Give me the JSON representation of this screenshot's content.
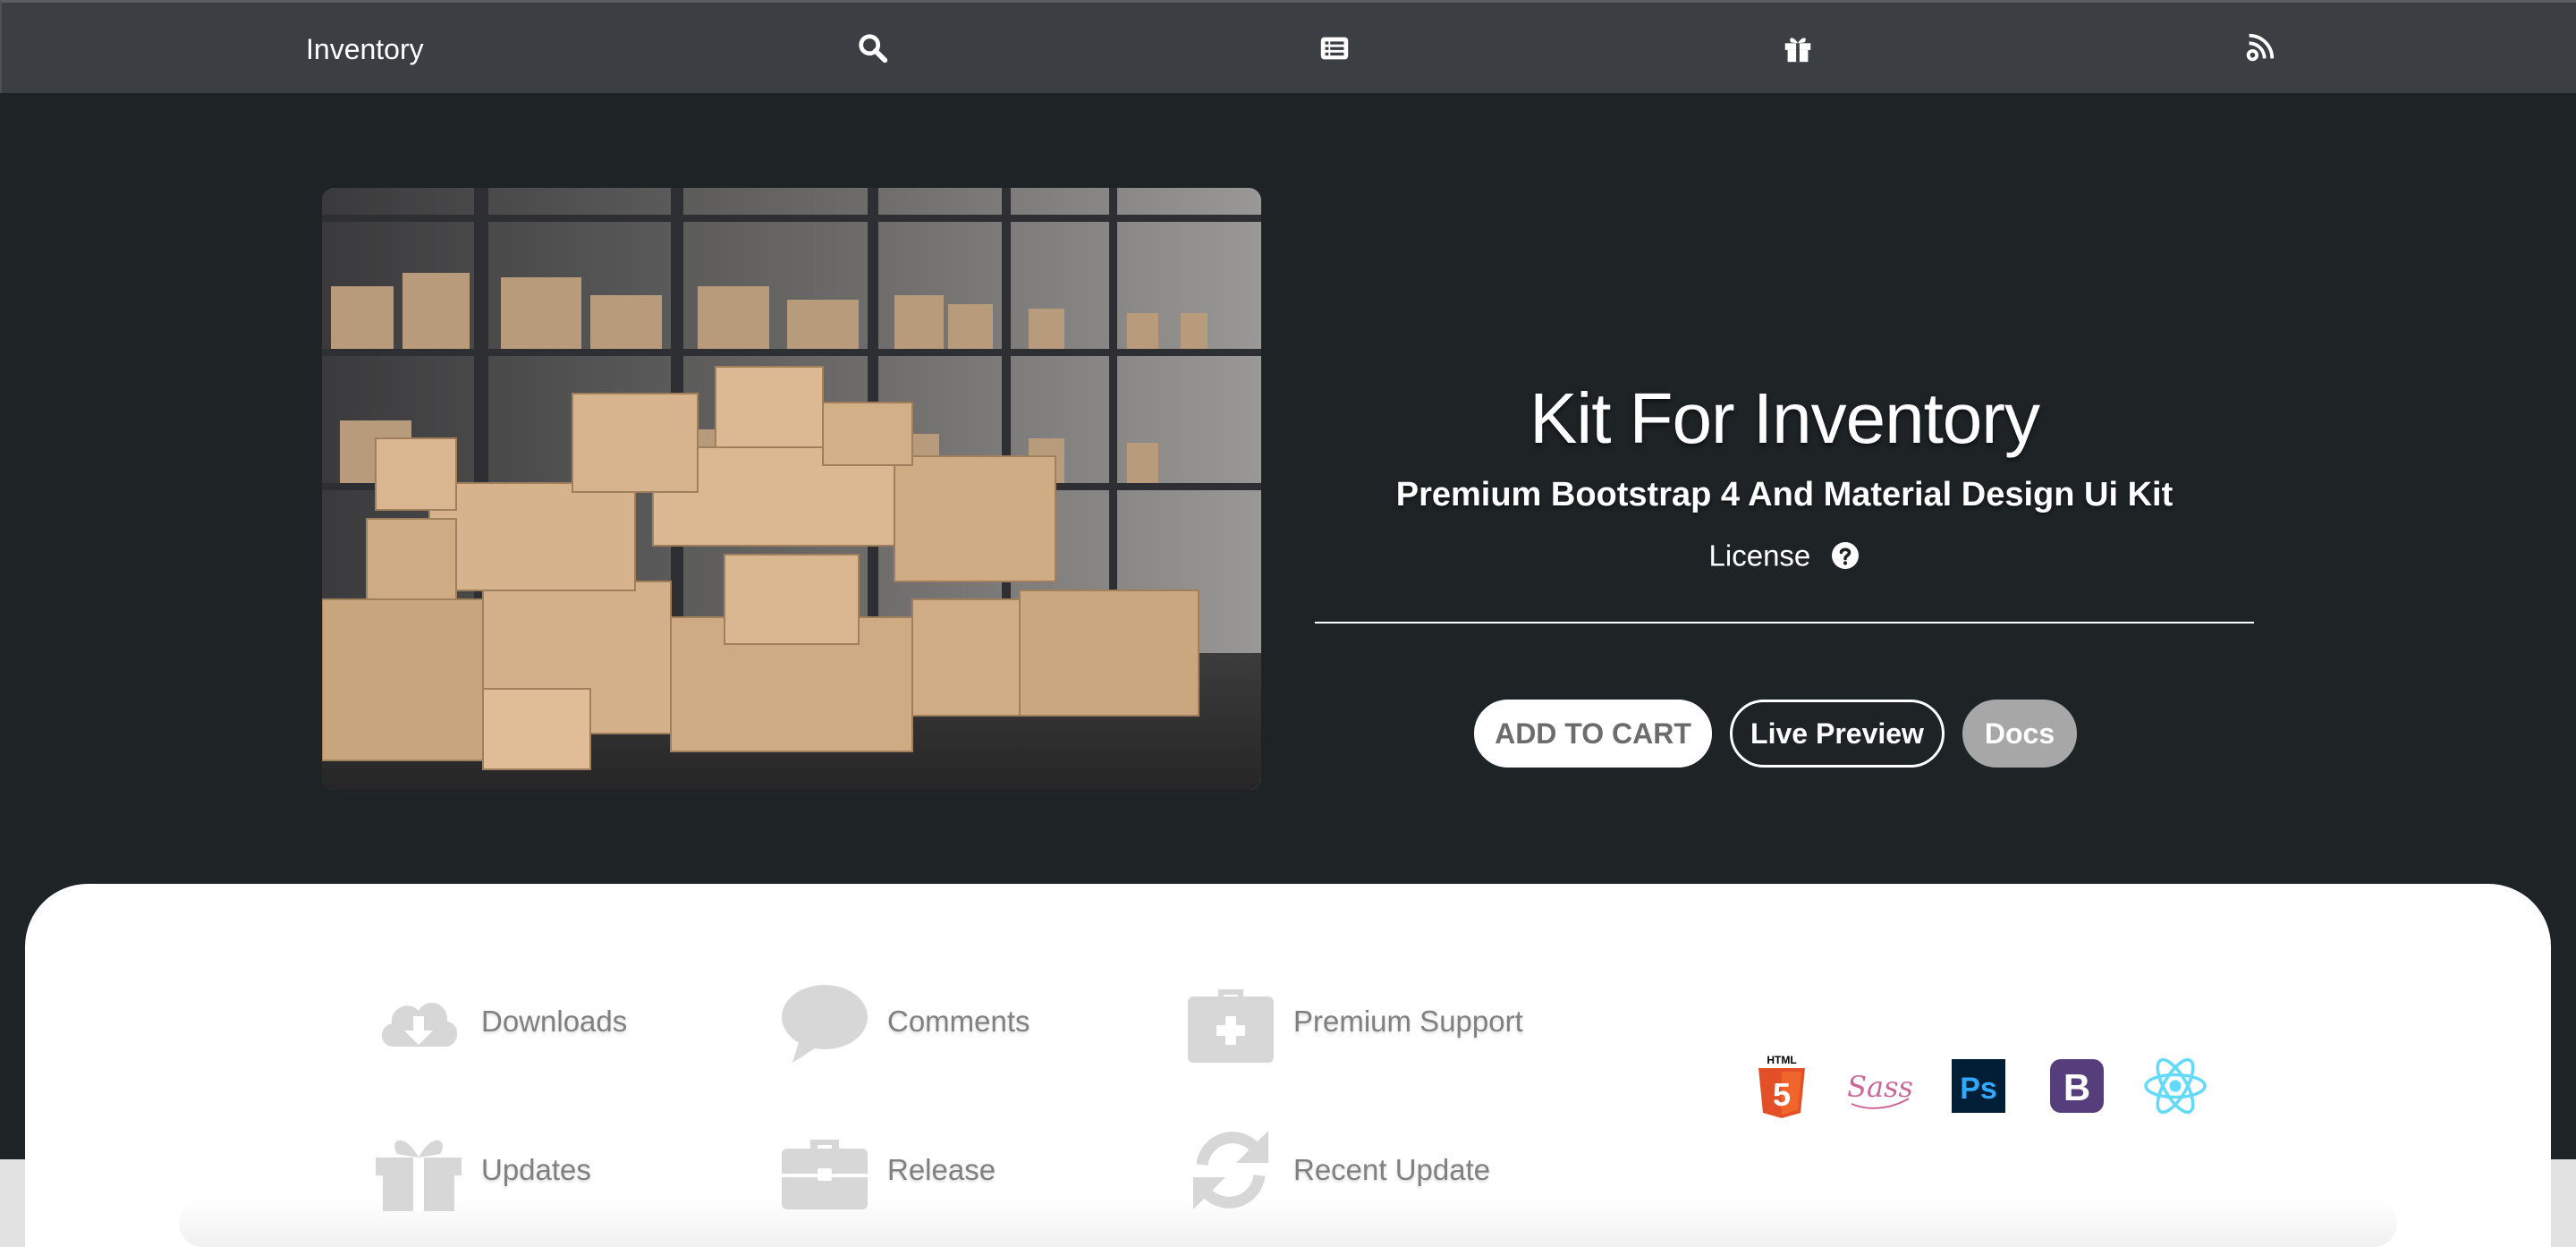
{
  "nav": {
    "brand": "Inventory",
    "icons": [
      "search-icon",
      "list-icon",
      "gift-icon",
      "feed-icon"
    ]
  },
  "product": {
    "title": "Kit For Inventory",
    "subtitle": "Premium Bootstrap 4 And Material Design Ui Kit",
    "license_label": "License",
    "buttons": {
      "add_to_cart": "ADD TO CART",
      "live_preview": "Live Preview",
      "docs": "Docs"
    }
  },
  "features": [
    {
      "label": "Downloads",
      "icon": "cloud-download-icon"
    },
    {
      "label": "Comments",
      "icon": "comment-icon"
    },
    {
      "label": "Premium Support",
      "icon": "medkit-icon"
    },
    {
      "label": "Updates",
      "icon": "gift-icon"
    },
    {
      "label": "Release",
      "icon": "briefcase-icon"
    },
    {
      "label": "Recent Update",
      "icon": "refresh-icon"
    }
  ],
  "technologies": [
    {
      "name": "HTML5",
      "icon": "html5-icon",
      "color": "#e34f26",
      "badge": "HTML",
      "digit": "5"
    },
    {
      "name": "Sass",
      "icon": "sass-icon",
      "color": "#cd6799",
      "badge": "Sass"
    },
    {
      "name": "Photoshop",
      "icon": "photoshop-icon",
      "color": "#31a8ff",
      "bg": "#001e36",
      "badge": "Ps"
    },
    {
      "name": "Bootstrap",
      "icon": "bootstrap-icon",
      "color": "#563d7c",
      "badge": "B"
    },
    {
      "name": "React",
      "icon": "react-icon",
      "color": "#61dafb"
    }
  ],
  "colors": {
    "page_background": "#1e2426",
    "navbar": "#3b3f44",
    "card": "#ffffff",
    "feature_gray": "#808080",
    "docs_button": "#a7a7a7"
  }
}
